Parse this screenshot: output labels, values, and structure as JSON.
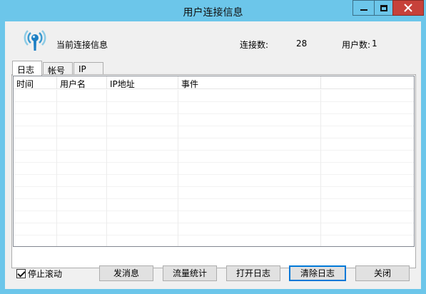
{
  "window": {
    "title": "用户连接信息",
    "close_color": "#c7413a",
    "titlebar_color": "#6cc6ea"
  },
  "header": {
    "icon": "signal-broadcast-icon",
    "label": "当前连接信息",
    "connections_label": "连接数:",
    "connections_value": "28",
    "users_label": "用户数:",
    "users_value": "1"
  },
  "tabs": [
    {
      "label": "日志",
      "active": true
    },
    {
      "label": "帐号",
      "active": false
    },
    {
      "label": "IP",
      "active": false
    }
  ],
  "log_table": {
    "columns": [
      "时间",
      "用户名",
      "IP地址",
      "事件",
      ""
    ],
    "rows": []
  },
  "footer": {
    "stop_scroll_label": "停止滚动",
    "stop_scroll_checked": true,
    "buttons": {
      "send_message": "发消息",
      "traffic_stats": "流量统计",
      "open_log": "打开日志",
      "clear_log": "清除日志",
      "close": "关闭"
    }
  }
}
